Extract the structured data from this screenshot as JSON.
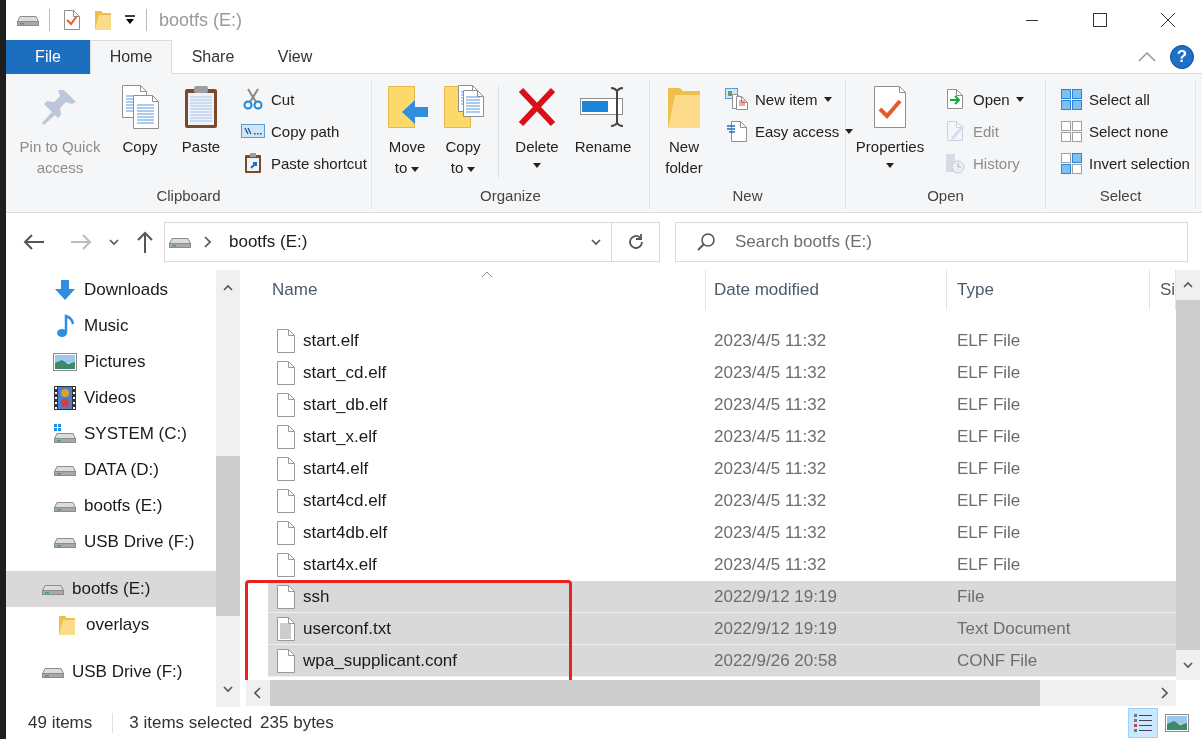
{
  "window": {
    "title": "bootfs (E:)"
  },
  "ribbon_tabs": [
    {
      "label": "File",
      "kind": "menu",
      "selected": false
    },
    {
      "label": "Home",
      "kind": "tab",
      "selected": true
    },
    {
      "label": "Share",
      "kind": "tab",
      "selected": false
    },
    {
      "label": "View",
      "kind": "tab",
      "selected": false
    }
  ],
  "help_button": {
    "label": "?"
  },
  "ribbon_groups": [
    {
      "label": "Clipboard",
      "items": [
        {
          "kind": "large",
          "label": "Pin to Quick access",
          "disabled": true
        },
        {
          "kind": "large",
          "label": "Copy",
          "disabled": false
        },
        {
          "kind": "large",
          "label": "Paste",
          "disabled": false
        },
        {
          "kind": "small",
          "label": "Cut",
          "disabled": false
        },
        {
          "kind": "small",
          "label": "Copy path",
          "disabled": false
        },
        {
          "kind": "small",
          "label": "Paste shortcut",
          "disabled": false
        }
      ]
    },
    {
      "label": "Organize",
      "items": [
        {
          "kind": "large",
          "label": "Move to",
          "dropdown": true,
          "disabled": false
        },
        {
          "kind": "large",
          "label": "Copy to",
          "dropdown": true,
          "disabled": false
        },
        {
          "kind": "large",
          "label": "Delete",
          "dropdown": true,
          "disabled": false
        },
        {
          "kind": "large",
          "label": "Rename",
          "disabled": false
        }
      ]
    },
    {
      "label": "New",
      "items": [
        {
          "kind": "large",
          "label": "New folder",
          "disabled": false
        },
        {
          "kind": "small",
          "label": "New item",
          "dropdown": true,
          "disabled": false
        },
        {
          "kind": "small",
          "label": "Easy access",
          "dropdown": true,
          "disabled": false
        }
      ]
    },
    {
      "label": "Open",
      "items": [
        {
          "kind": "large",
          "label": "Properties",
          "dropdown": true,
          "disabled": false
        },
        {
          "kind": "small",
          "label": "Open",
          "dropdown": true,
          "disabled": false
        },
        {
          "kind": "small",
          "label": "Edit",
          "disabled": true
        },
        {
          "kind": "small",
          "label": "History",
          "disabled": true
        }
      ]
    },
    {
      "label": "Select",
      "items": [
        {
          "kind": "small",
          "label": "Select all",
          "disabled": false
        },
        {
          "kind": "small",
          "label": "Select none",
          "disabled": false
        },
        {
          "kind": "small",
          "label": "Invert selection",
          "disabled": false
        }
      ]
    }
  ],
  "address_bar": {
    "path": "bootfs (E:)"
  },
  "search": {
    "placeholder": "Search bootfs (E:)"
  },
  "nav_pane": {
    "quick_items": [
      {
        "label": "Downloads",
        "selected": false
      },
      {
        "label": "Music",
        "selected": false
      },
      {
        "label": "Pictures",
        "selected": false
      },
      {
        "label": "Videos",
        "selected": false
      },
      {
        "label": "SYSTEM (C:)",
        "selected": false
      },
      {
        "label": "DATA (D:)",
        "selected": false
      },
      {
        "label": "bootfs (E:)",
        "selected": false
      },
      {
        "label": "USB Drive (F:)",
        "selected": false
      }
    ],
    "drives": [
      {
        "label": "bootfs (E:)",
        "selected": true,
        "children": [
          {
            "label": "overlays",
            "selected": false
          }
        ]
      },
      {
        "label": "USB Drive (F:)",
        "selected": false
      }
    ]
  },
  "file_list": {
    "columns": [
      {
        "label": "Name",
        "sorted": true
      },
      {
        "label": "Date modified",
        "sorted": false
      },
      {
        "label": "Type",
        "sorted": false
      },
      {
        "label": "Si",
        "sorted": false
      }
    ],
    "rows": [
      {
        "name": "start.elf",
        "date": "2023/4/5 11:32",
        "type": "ELF File",
        "kind": "file",
        "selected": false
      },
      {
        "name": "start_cd.elf",
        "date": "2023/4/5 11:32",
        "type": "ELF File",
        "kind": "file",
        "selected": false
      },
      {
        "name": "start_db.elf",
        "date": "2023/4/5 11:32",
        "type": "ELF File",
        "kind": "file",
        "selected": false
      },
      {
        "name": "start_x.elf",
        "date": "2023/4/5 11:32",
        "type": "ELF File",
        "kind": "file",
        "selected": false
      },
      {
        "name": "start4.elf",
        "date": "2023/4/5 11:32",
        "type": "ELF File",
        "kind": "file",
        "selected": false
      },
      {
        "name": "start4cd.elf",
        "date": "2023/4/5 11:32",
        "type": "ELF File",
        "kind": "file",
        "selected": false
      },
      {
        "name": "start4db.elf",
        "date": "2023/4/5 11:32",
        "type": "ELF File",
        "kind": "file",
        "selected": false
      },
      {
        "name": "start4x.elf",
        "date": "2023/4/5 11:32",
        "type": "ELF File",
        "kind": "file",
        "selected": false
      },
      {
        "name": "ssh",
        "date": "2022/9/12 19:19",
        "type": "File",
        "kind": "file",
        "selected": true
      },
      {
        "name": "userconf.txt",
        "date": "2022/9/12 19:19",
        "type": "Text Document",
        "kind": "text",
        "selected": true
      },
      {
        "name": "wpa_supplicant.conf",
        "date": "2022/9/26 20:58",
        "type": "CONF File",
        "kind": "file",
        "selected": true
      }
    ]
  },
  "highlight": {
    "kind": "rectangle"
  },
  "status_bar": {
    "item_count": "49 items",
    "selection": "3 items selected",
    "size": "235 bytes"
  },
  "view_buttons": [
    {
      "kind": "details",
      "selected": true
    },
    {
      "kind": "thumbnails",
      "selected": false
    }
  ]
}
